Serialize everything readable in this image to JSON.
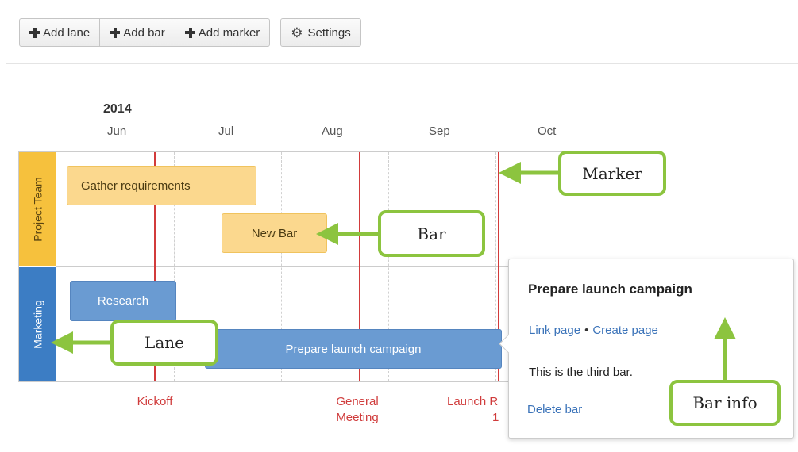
{
  "toolbar": {
    "add_lane": "Add lane",
    "add_bar": "Add bar",
    "add_marker": "Add marker",
    "settings": "Settings"
  },
  "timeline": {
    "year": "2014",
    "months": [
      "Jun",
      "Jul",
      "Aug",
      "Sep",
      "Oct"
    ]
  },
  "lanes": [
    {
      "label": "Project Team",
      "color": "#f6c13d"
    },
    {
      "label": "Marketing",
      "color": "#3c7dc4"
    }
  ],
  "bars": [
    {
      "label": "Gather requirements",
      "lane": "Project Team",
      "color": "#fbd88e"
    },
    {
      "label": "New Bar",
      "lane": "Project Team",
      "color": "#fbd88e"
    },
    {
      "label": "Research",
      "lane": "Marketing",
      "color": "#6a9bd2"
    },
    {
      "label": "Prepare launch campaign",
      "lane": "Marketing",
      "color": "#6a9bd2"
    }
  ],
  "markers": [
    {
      "line1": "Kickoff",
      "line2": "",
      "color": "#d23b3b"
    },
    {
      "line1": "General",
      "line2": "Meeting",
      "color": "#d23b3b"
    },
    {
      "line1": "Launch R",
      "line2": "1",
      "color": "#d23b3b"
    }
  ],
  "bar_info": {
    "title": "Prepare launch campaign",
    "link_page": "Link page",
    "separator": "•",
    "create_page": "Create page",
    "description": "This is the third bar.",
    "delete": "Delete bar"
  },
  "callouts": {
    "marker": "Marker",
    "bar": "Bar",
    "lane": "Lane",
    "bar_info": "Bar info",
    "accent": "#8cc43f"
  },
  "icons": {
    "add": "plus-icon",
    "settings": "gear-icon"
  }
}
